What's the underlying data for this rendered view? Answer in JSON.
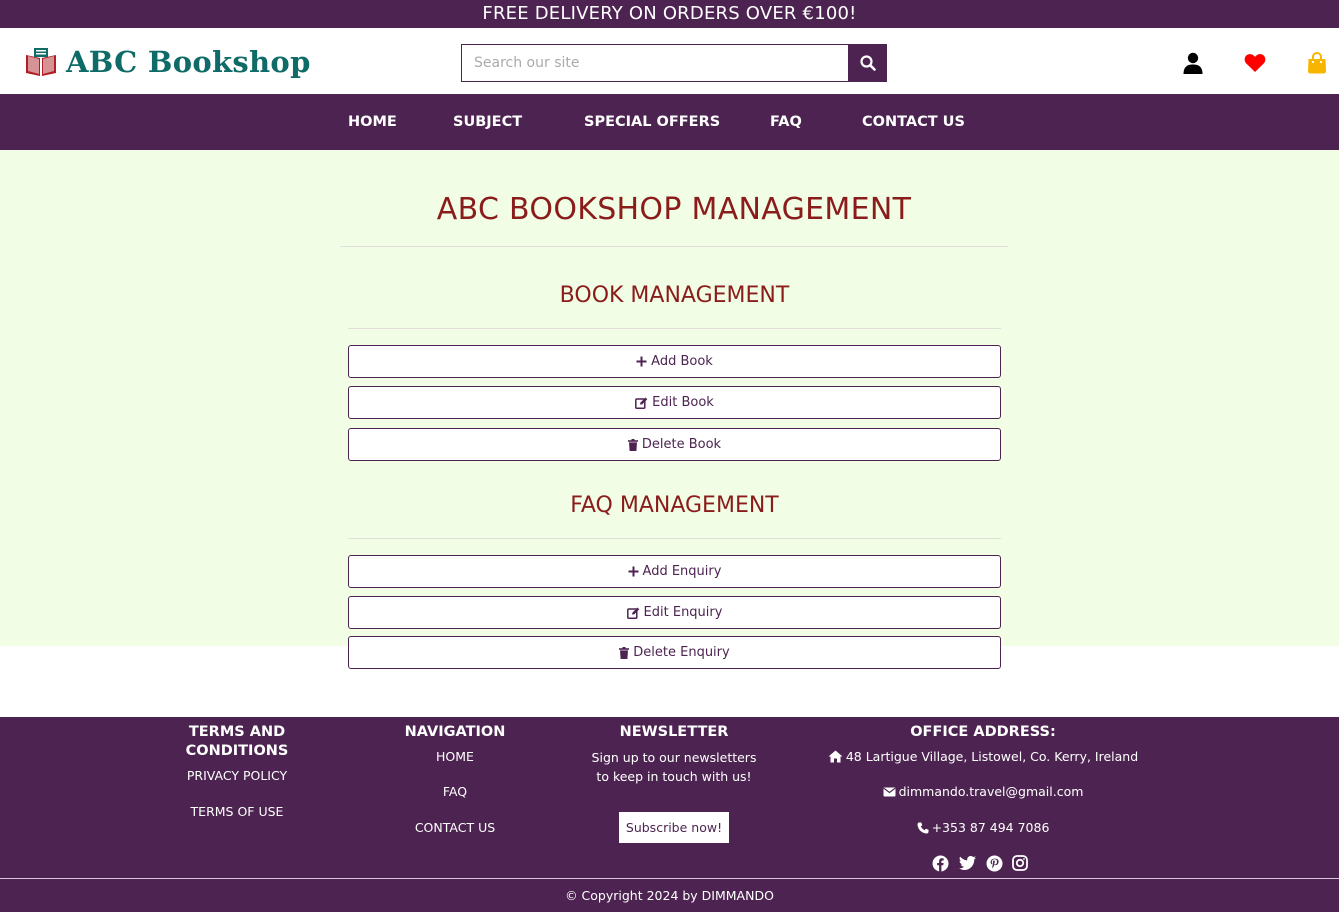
{
  "promo": {
    "text": "FREE DELIVERY ON ORDERS OVER €100!"
  },
  "header": {
    "logo_text": "ABC Bookshop",
    "search_placeholder": "Search our site",
    "icons": [
      "search-icon",
      "user-icon",
      "heart-icon",
      "shopping-bag-icon"
    ]
  },
  "nav": {
    "items": [
      {
        "label": "HOME"
      },
      {
        "label": "SUBJECT"
      },
      {
        "label": "SPECIAL OFFERS"
      },
      {
        "label": "FAQ"
      },
      {
        "label": "CONTACT US"
      }
    ]
  },
  "main": {
    "title": "ABC BOOKSHOP MANAGEMENT",
    "book_section": {
      "title": "BOOK MANAGEMENT",
      "buttons": [
        {
          "label": "Add Book",
          "icon": "plus-icon"
        },
        {
          "label": "Edit Book",
          "icon": "edit-icon"
        },
        {
          "label": "Delete Book",
          "icon": "trash-icon"
        }
      ]
    },
    "faq_section": {
      "title": "FAQ MANAGEMENT",
      "buttons": [
        {
          "label": "Add Enquiry",
          "icon": "plus-icon"
        },
        {
          "label": "Edit Enquiry",
          "icon": "edit-icon"
        },
        {
          "label": "Delete Enquiry",
          "icon": "trash-icon"
        }
      ]
    }
  },
  "footer": {
    "terms": {
      "title_line1": "TERMS AND",
      "title_line2": "CONDITIONS",
      "links": [
        "PRIVACY POLICY",
        "TERMS OF USE"
      ]
    },
    "navigation": {
      "title": "NAVIGATION",
      "links": [
        "HOME",
        "FAQ",
        "CONTACT US"
      ]
    },
    "newsletter": {
      "title": "NEWSLETTER",
      "text_line1": "Sign up to our newsletters",
      "text_line2": "to keep in touch with us!",
      "button": "Subscribe now!"
    },
    "office": {
      "title": "OFFICE ADDRESS:",
      "address": "48 Lartigue Village, Listowel, Co. Kerry, Ireland",
      "email": "dimmando.travel@gmail.com",
      "phone": "+353 87 494 7086",
      "social": [
        "facebook-icon",
        "twitter-icon",
        "pinterest-icon",
        "instagram-icon"
      ]
    },
    "copyright": "© Copyright 2024 by DIMMANDO"
  },
  "colors": {
    "brand_purple": "#4d2451",
    "logo_teal": "#0f6b67",
    "heading_red": "#8b1c1c",
    "main_bg": "#f1fde4",
    "heart_red": "#ff0000",
    "bag_yellow": "#f7b500"
  }
}
